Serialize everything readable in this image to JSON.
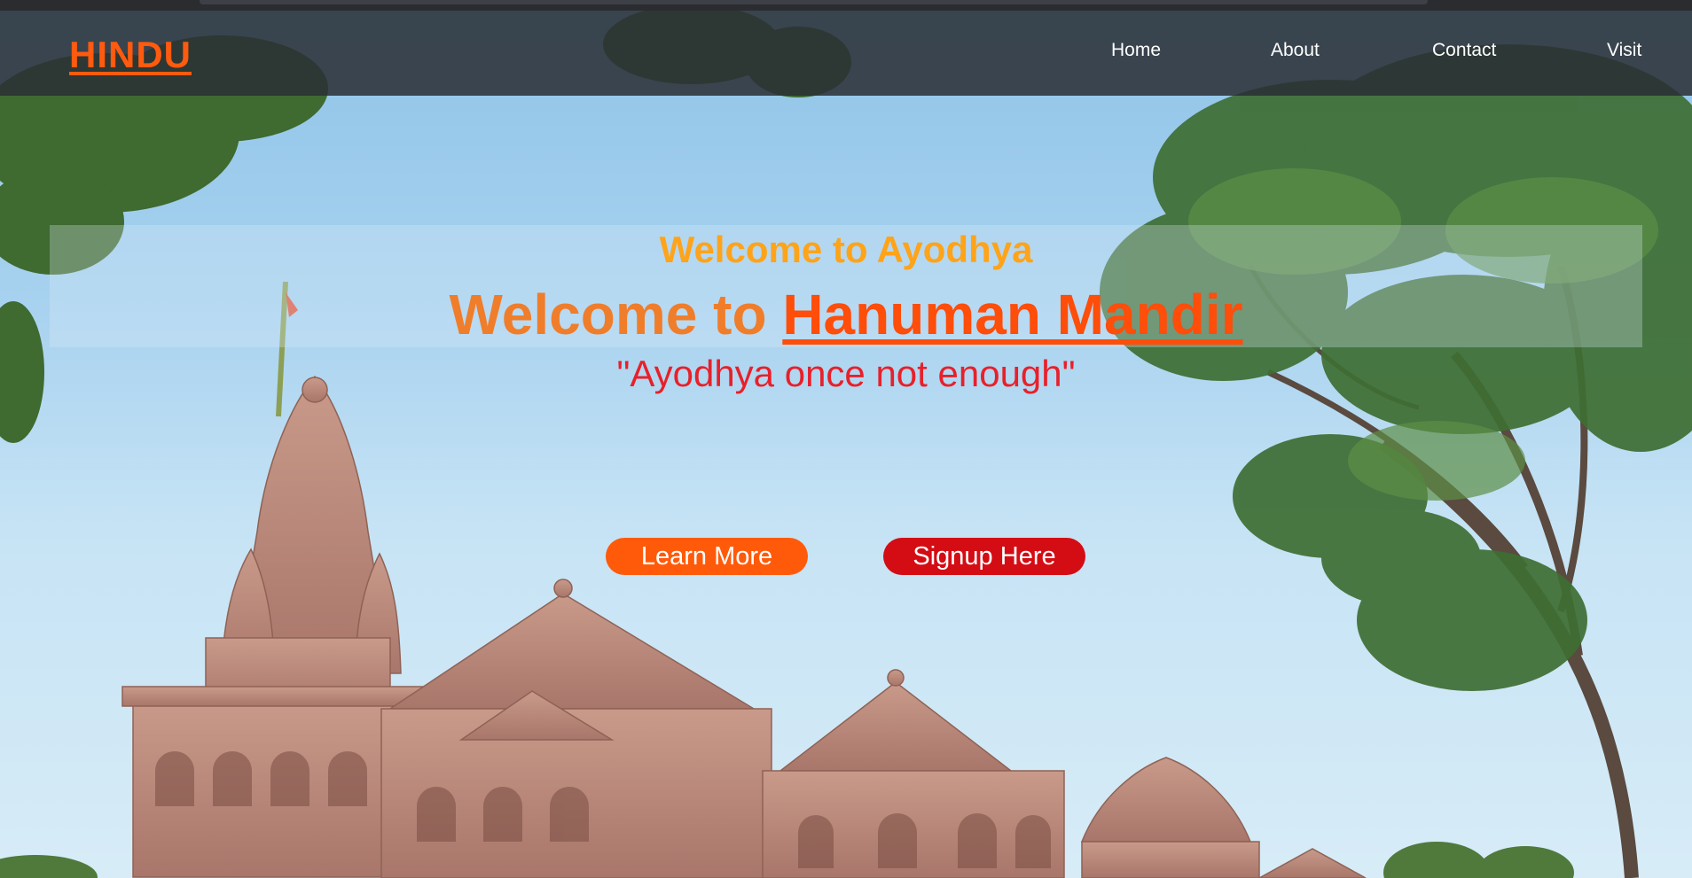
{
  "nav": {
    "brand": "HINDU",
    "links": [
      "Home",
      "About",
      "Contact",
      "Visit"
    ]
  },
  "hero": {
    "welcome_small": "Welcome to Ayodhya",
    "welcome_prefix": "Welcome to ",
    "welcome_highlight": "Hanuman Mandir",
    "tagline": "\"Ayodhya once not enough\""
  },
  "buttons": {
    "learn_more": "Learn More",
    "signup": "Signup Here"
  },
  "colors": {
    "brand": "#ff5a0e",
    "navbar": "#2a2e34",
    "learn_button": "#ff5a0a",
    "signup_button": "#d40c14"
  }
}
